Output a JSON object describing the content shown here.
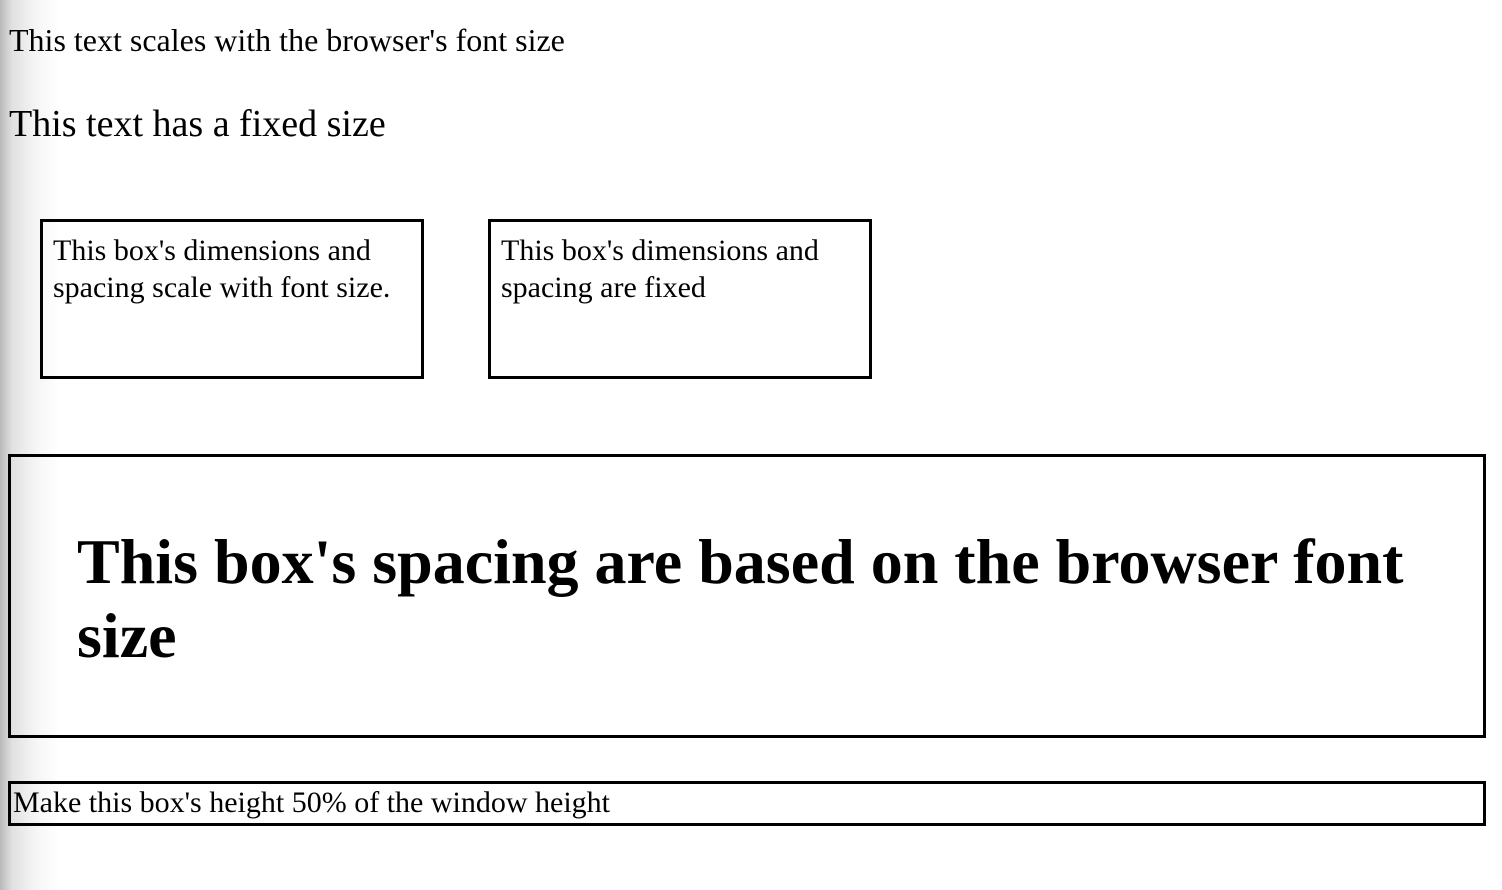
{
  "text_blocks": {
    "scales_text": "This text scales with the browser's font size",
    "fixed_text": "This text has a fixed size"
  },
  "boxes": {
    "scale_box_text": "This box's dimensions and spacing scale with font size.",
    "fixed_box_text": "This box's dimensions and spacing are fixed",
    "spacing_box_heading": "This box's spacing are based on the browser font size",
    "height_box_text": "Make this box's height 50% of the window height"
  }
}
